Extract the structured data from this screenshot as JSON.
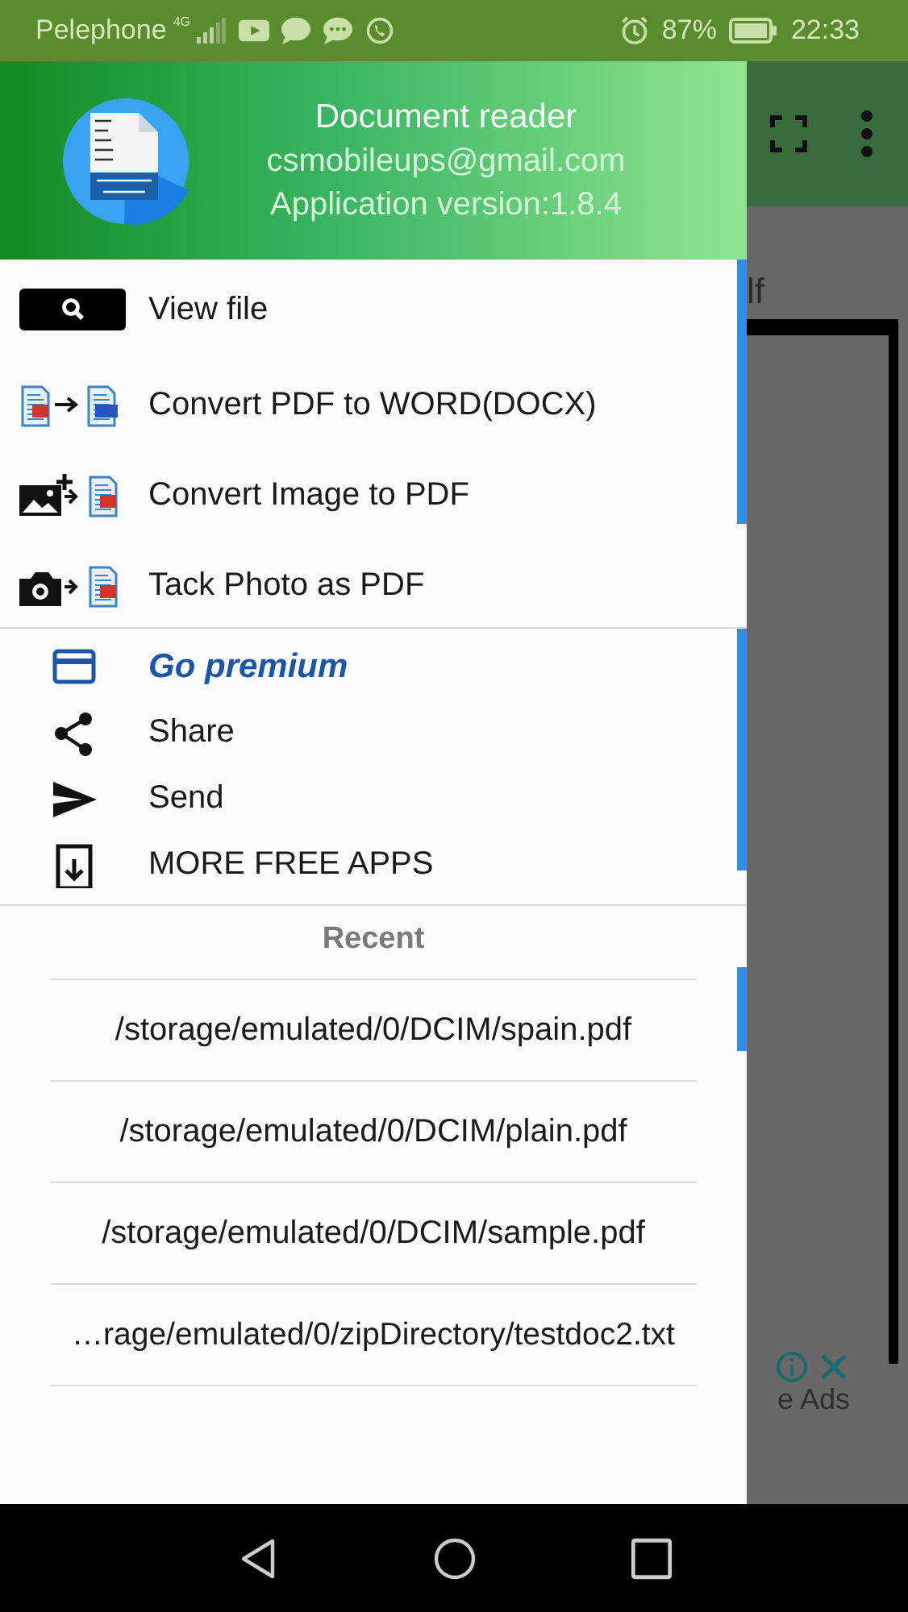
{
  "status_bar": {
    "carrier": "Pelephone",
    "network": "4G",
    "battery": "87%",
    "time": "22:33"
  },
  "drawer": {
    "header": {
      "title": "Document reader",
      "email": "csmobileups@gmail.com",
      "version": "Application version:1.8.4"
    },
    "tools": [
      {
        "kind": "view",
        "label": "View file"
      },
      {
        "kind": "pdf-to-docx",
        "label": "Convert PDF to WORD(DOCX)"
      },
      {
        "kind": "image-to-pdf",
        "label": "Convert Image to PDF"
      },
      {
        "kind": "photo-to-pdf",
        "label": "Tack Photo as PDF"
      }
    ],
    "actions": [
      {
        "kind": "premium",
        "label": "Go premium"
      },
      {
        "kind": "share",
        "label": "Share"
      },
      {
        "kind": "send",
        "label": "Send"
      },
      {
        "kind": "apps",
        "label": "MORE FREE APPS"
      }
    ],
    "recent": {
      "title": "Recent",
      "files": [
        "/storage/emulated/0/DCIM/spain.pdf",
        "/storage/emulated/0/DCIM/plain.pdf",
        "/storage/emulated/0/DCIM/sample.pdf",
        "…rage/emulated/0/zipDirectory/testdoc2.txt"
      ]
    }
  },
  "background": {
    "partial_text": "lf",
    "ad_label": "e Ads"
  }
}
